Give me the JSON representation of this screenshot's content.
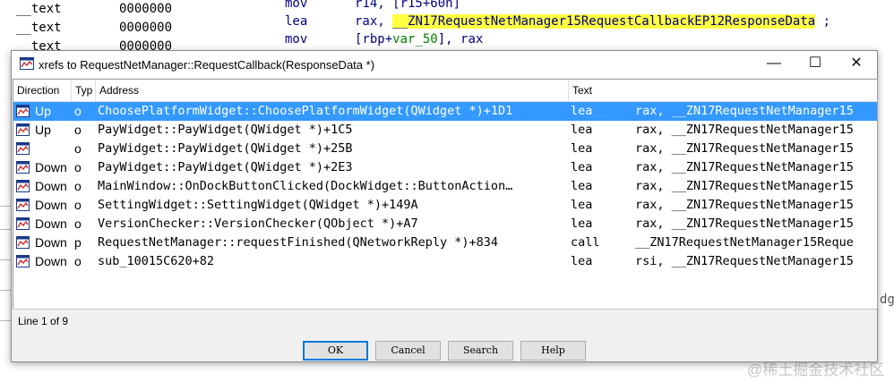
{
  "background": {
    "names_rows": [
      {
        "name": "__text",
        "addr": "0000000"
      },
      {
        "name": "__text",
        "addr": "0000000"
      },
      {
        "name": "__text",
        "addr": "0000000"
      }
    ],
    "disasm": [
      {
        "op": "mov",
        "args": "r14, [r15+60h]"
      },
      {
        "op": "lea",
        "args_prefix": "rax, ",
        "symbol": "__ZN17RequestNetManager15RequestCallbackEP12ResponseData",
        "suffix": " ;"
      },
      {
        "op": "mov",
        "args_prefix": "[rbp+",
        "var": "var_50",
        "args_suffix": "], rax"
      }
    ],
    "edge_fragment": "dg",
    "watermark": "@稀土掘金技术社区"
  },
  "dialog": {
    "title": "xrefs to RequestNetManager::RequestCallback(ResponseData *)",
    "window_buttons": {
      "minimize": "—",
      "maximize": "☐",
      "close": "✕"
    },
    "columns": {
      "direction": "Direction",
      "type": "Typ",
      "address": "Address",
      "text": "Text"
    },
    "rows": [
      {
        "direction": "Up",
        "type": "o",
        "address": "ChoosePlatformWidget::ChoosePlatformWidget(QWidget *)+1D1",
        "mnemonic": "lea",
        "operands": "rax, __ZN17RequestNetManager15"
      },
      {
        "direction": "Up",
        "type": "o",
        "address": "PayWidget::PayWidget(QWidget *)+1C5",
        "mnemonic": "lea",
        "operands": "rax, __ZN17RequestNetManager15"
      },
      {
        "direction": "",
        "type": "o",
        "address": "PayWidget::PayWidget(QWidget *)+25B",
        "mnemonic": "lea",
        "operands": "rax, __ZN17RequestNetManager15"
      },
      {
        "direction": "Down",
        "type": "o",
        "address": "PayWidget::PayWidget(QWidget *)+2E3",
        "mnemonic": "lea",
        "operands": "rax, __ZN17RequestNetManager15"
      },
      {
        "direction": "Down",
        "type": "o",
        "address": "MainWindow::OnDockButtonClicked(DockWidget::ButtonAction…",
        "mnemonic": "lea",
        "operands": "rax, __ZN17RequestNetManager15"
      },
      {
        "direction": "Down",
        "type": "o",
        "address": "SettingWidget::SettingWidget(QWidget *)+149A",
        "mnemonic": "lea",
        "operands": "rax, __ZN17RequestNetManager15"
      },
      {
        "direction": "Down",
        "type": "o",
        "address": "VersionChecker::VersionChecker(QObject *)+A7",
        "mnemonic": "lea",
        "operands": "rax, __ZN17RequestNetManager15"
      },
      {
        "direction": "Down",
        "type": "p",
        "address": "RequestNetManager::requestFinished(QNetworkReply *)+834",
        "mnemonic": "call",
        "operands": "__ZN17RequestNetManager15Reque"
      },
      {
        "direction": "Down",
        "type": "o",
        "address": "sub_10015C620+82",
        "mnemonic": "lea",
        "operands": "rsi, __ZN17RequestNetManager15"
      }
    ],
    "selected_row": 0,
    "status": "Line 1 of 9",
    "buttons": {
      "ok": "OK",
      "cancel": "Cancel",
      "search": "Search",
      "help": "Help"
    }
  },
  "colors": {
    "selection": "#3399ff",
    "highlight": "#ffff40",
    "asm_text": "#000080"
  }
}
